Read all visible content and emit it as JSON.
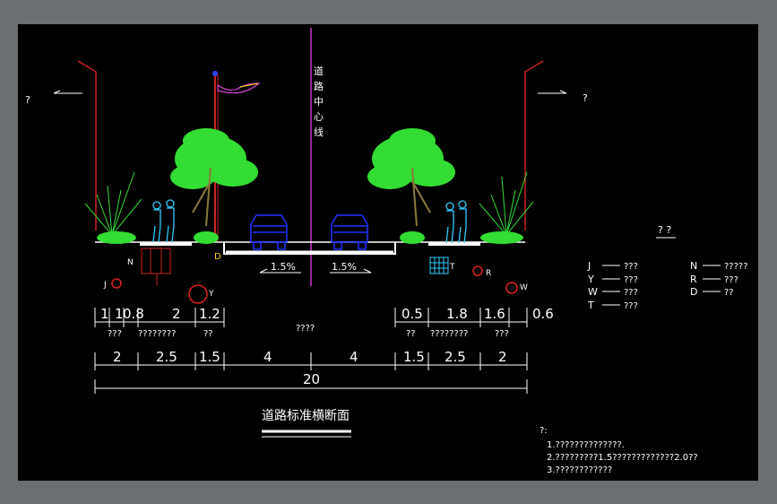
{
  "title": "道路标准横断面",
  "centerline_label": [
    "道",
    "路",
    "中",
    "心",
    "线"
  ],
  "side_marks": {
    "left": "?",
    "right": "?"
  },
  "slopes": {
    "left": "1.5%",
    "right": "1.5%"
  },
  "labels": {
    "n": "N",
    "d": "D",
    "t": "T",
    "r": "R",
    "w": "W",
    "j": "J",
    "y": "Y"
  },
  "top_dims": {
    "left": [
      "1",
      "1",
      "0.8",
      "2",
      "1.2"
    ],
    "right": [
      "0.5",
      "1.8",
      "1.6",
      "0.6"
    ]
  },
  "top_dim_notes": {
    "left": [
      "???",
      "????????",
      "??"
    ],
    "center": "????",
    "right": [
      "??",
      "????????",
      "???"
    ]
  },
  "bottom_dims": [
    "2",
    "2.5",
    "1.5",
    "4",
    "4",
    "1.5",
    "2.5",
    "2"
  ],
  "total_width": "20",
  "legend": {
    "title": "? ?",
    "items": [
      {
        "key": "J",
        "text": "???"
      },
      {
        "key": "N",
        "text": "?????"
      },
      {
        "key": "Y",
        "text": "???"
      },
      {
        "key": "R",
        "text": "???"
      },
      {
        "key": "W",
        "text": "???"
      },
      {
        "key": "D",
        "text": "??"
      },
      {
        "key": "T",
        "text": "???"
      }
    ]
  },
  "notes": {
    "heading": "?:",
    "lines": [
      "1.??????????????.",
      "2.?????????1.5?????????????2.0??",
      "3.????????????"
    ]
  },
  "colors": {
    "background": "#000000",
    "frame": "#6b6e72",
    "centerline": "#cc33cc",
    "building": "#cc2222",
    "tree": "#33dd33",
    "car": "#2233ff",
    "person": "#33ccff",
    "text": "#ffffff"
  }
}
